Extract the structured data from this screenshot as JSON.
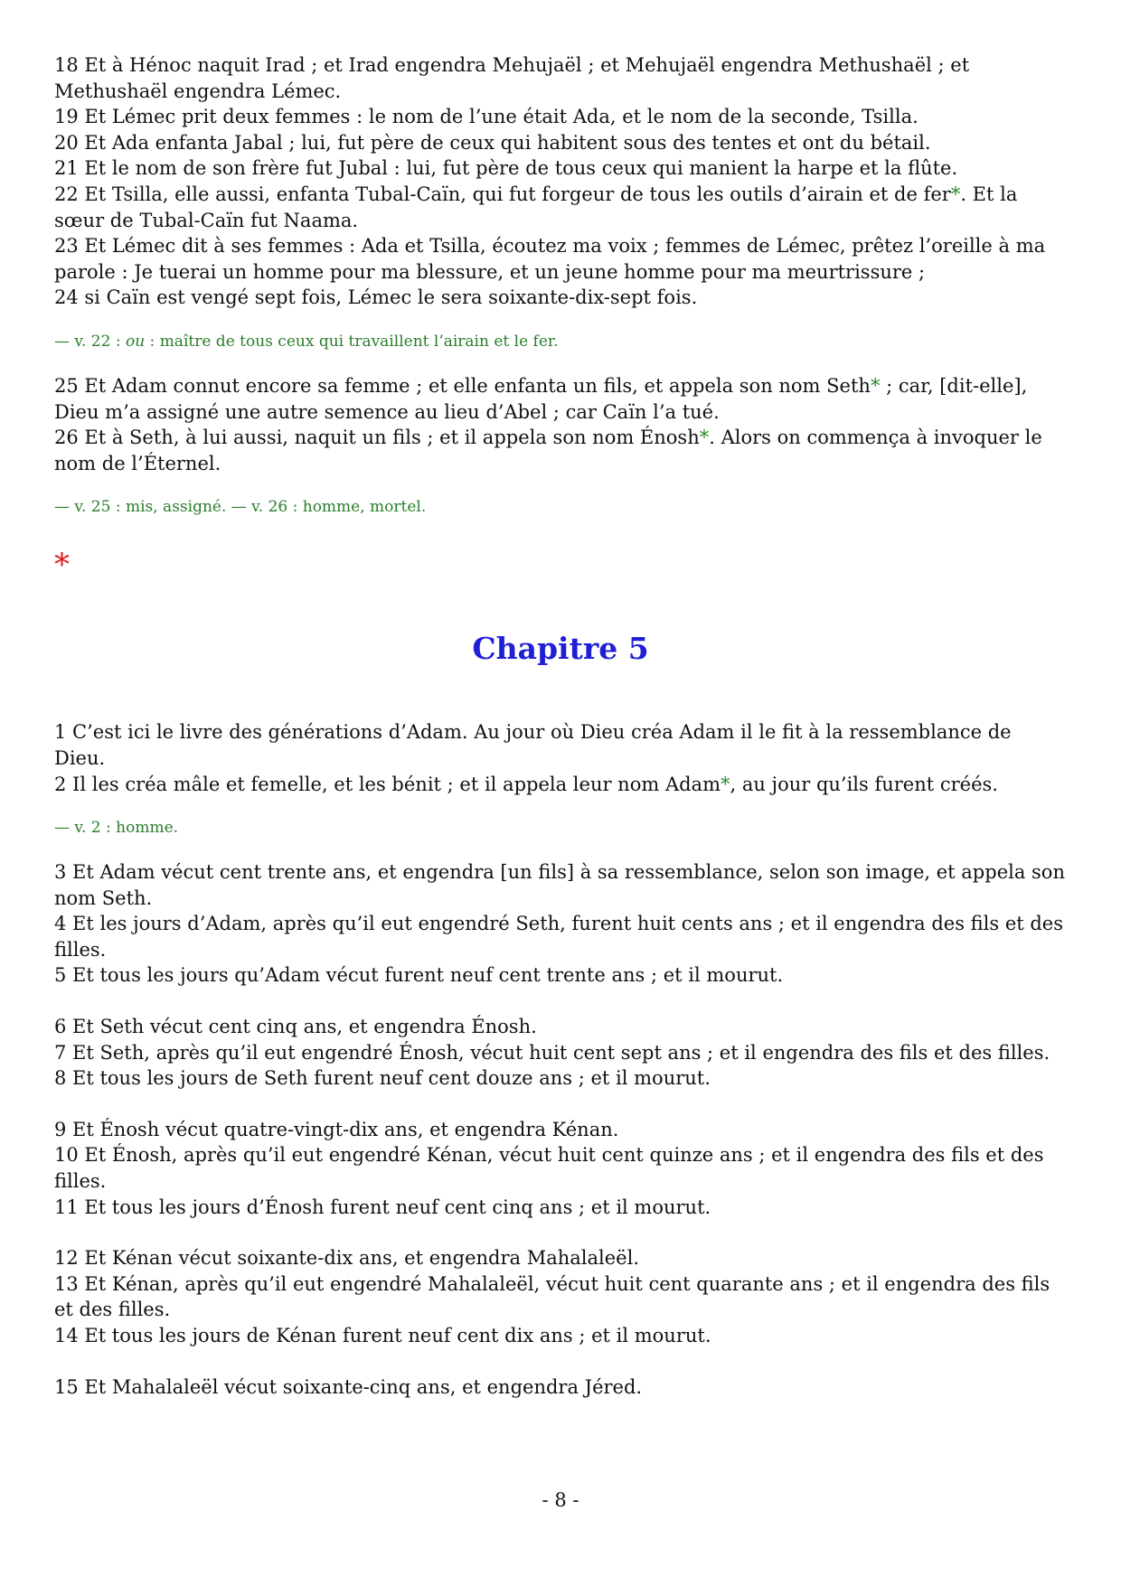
{
  "blocks_top": {
    "b1": {
      "v18": "18 Et à Hénoc naquit Irad ; et Irad engendra Mehujaël ; et Mehujaël engendra Methushaël ; et Methushaël engendra Lémec.",
      "v19": "19 Et Lémec prit deux femmes : le nom de l’une était Ada, et le nom de la seconde, Tsilla.",
      "v20": "20 Et Ada enfanta Jabal ; lui, fut père de ceux qui habitent sous des tentes et ont du bétail.",
      "v21": "21 Et le nom de son frère fut Jubal : lui, fut père de tous ceux qui manient la harpe et la flûte.",
      "v22a": "22 Et Tsilla, elle aussi, enfanta Tubal-Caïn, qui fut forgeur de tous les outils d’airain et de fer",
      "v22b": ". Et la sœur de Tubal-Caïn fut Naama.",
      "v23": "23 Et Lémec dit à ses femmes : Ada et Tsilla, écoutez ma voix ; femmes de Lémec, prêtez l’oreille à ma parole : Je tuerai un homme pour ma blessure, et un jeune homme pour ma meurtrissure ;",
      "v24": "24 si Caïn est vengé sept fois, Lémec le sera soixante-dix-sept fois.",
      "note_a": "— v. 22 : ",
      "note_ou": "ou",
      "note_b": " : maître de tous ceux qui travaillent l’airain et le fer."
    },
    "b2": {
      "v25a": "25 Et Adam connut encore sa femme ; et elle enfanta un fils, et appela son nom Seth",
      "v25b": " ; car, [dit-elle], Dieu m’a assigné une autre semence au lieu d’Abel ; car Caïn l’a tué.",
      "v26a": "26 Et à Seth, à lui aussi, naquit un fils ; et il appela son nom Énosh",
      "v26b": ". Alors on commença à invoquer le nom de l’Éternel.",
      "note": "— v. 25 : mis, assigné. — v. 26 : homme, mortel."
    }
  },
  "star": "*",
  "separator": "*",
  "chapter_title": "Chapitre 5",
  "chapter5": {
    "c1": {
      "v1": "1 C’est ici le livre des générations d’Adam. Au jour où Dieu créa Adam il le fit à la ressemblance de Dieu.",
      "v2a": "2 Il les créa mâle et femelle, et les bénit ; et il appela leur nom Adam",
      "v2b": ", au jour qu’ils furent créés.",
      "note": "— v. 2 : homme."
    },
    "c2": {
      "v3": "3 Et Adam vécut cent trente ans, et engendra [un fils] à sa ressemblance, selon son image, et appela son nom Seth.",
      "v4": "4 Et les jours d’Adam, après qu’il eut engendré Seth, furent huit cents ans ; et il engendra des fils et des filles.",
      "v5": "5 Et tous les jours qu’Adam vécut furent neuf cent trente ans ; et il mourut."
    },
    "c3": {
      "v6": "6 Et Seth vécut cent cinq ans, et engendra Énosh.",
      "v7": "7 Et Seth, après qu’il eut engendré Énosh, vécut huit cent sept ans ; et il engendra des fils et des filles.",
      "v8": "8 Et tous les jours de Seth furent neuf cent douze ans ; et il mourut."
    },
    "c4": {
      "v9": "9 Et Énosh vécut quatre-vingt-dix ans, et engendra Kénan.",
      "v10": "10 Et Énosh, après qu’il eut engendré Kénan, vécut huit cent quinze ans ; et il engendra des fils et des filles.",
      "v11": "11 Et tous les jours d’Énosh furent neuf cent cinq ans ; et il mourut."
    },
    "c5": {
      "v12": "12 Et Kénan vécut soixante-dix ans, et engendra Mahalaleël.",
      "v13": "13 Et Kénan, après qu’il eut engendré Mahalaleël, vécut huit cent quarante ans ; et il engendra des fils et des filles.",
      "v14": "14 Et tous les jours de Kénan furent neuf cent dix ans ; et il mourut."
    },
    "c6": {
      "v15": "15 Et Mahalaleël vécut soixante-cinq ans, et engendra Jéred."
    }
  },
  "page_number": "- 8 -",
  "colors": {
    "chapter_title": "#1f1fd6",
    "note_text": "#2a7d2a",
    "separator_star": "#e01b1b"
  }
}
